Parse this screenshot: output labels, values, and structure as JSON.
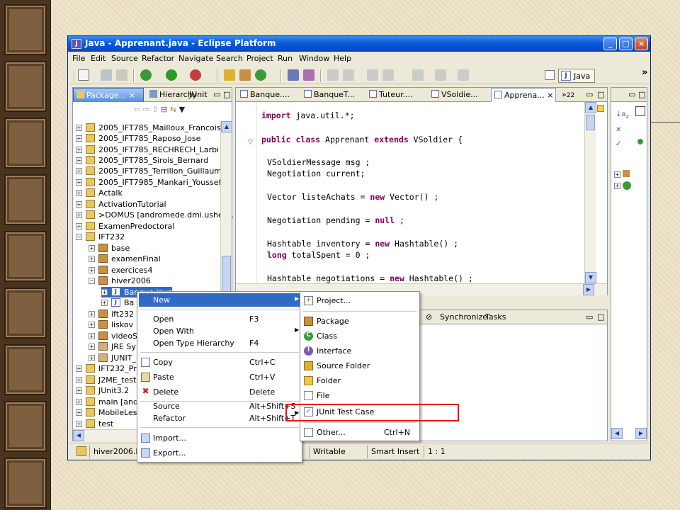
{
  "window": {
    "title": "Java - Apprenant.java - Eclipse Platform",
    "icon": "eclipse-icon"
  },
  "menubar": [
    "File",
    "Edit",
    "Source",
    "Refactor",
    "Navigate",
    "Search",
    "Project",
    "Run",
    "Window",
    "Help"
  ],
  "perspective": {
    "label": "Java",
    "overflow": "»"
  },
  "package_explorer": {
    "tabs": [
      "Package...",
      "Hierarchy",
      "JUnit"
    ],
    "items": [
      "2005_IFT785_Mailloux_Francois",
      "2005_IFT785_Raposo_Jose",
      "2005_IFT785_RECHRECH_Larbi",
      "2005_IFT785_Sirois_Bernard",
      "2005_IFT785_Terrillon_Guillaume",
      "2005_IFT7985_Mankari_Youssef",
      "Actalk",
      "ActivationTutorial",
      ">DOMUS  [andromede.dmi.usherb.",
      "ExamenPredoctoral",
      "IFT232",
      "base",
      "examenFinal",
      "exercices4",
      "hiver2006",
      "Banque.java",
      "Ba",
      "ift232",
      "liskov",
      "videoS",
      "JRE Sy",
      "JUNIT_",
      "IFT232_Pro",
      "J2ME_tests",
      "JUnit3.2",
      "main  [and",
      "MobileLess",
      "test"
    ]
  },
  "editor": {
    "tabs": [
      "Banque....",
      "BanqueT...",
      "Tuteur....",
      "VSoldie...",
      "Apprena...",
      "22"
    ],
    "overflow": "»",
    "code": {
      "l1_kw": "import",
      "l1_rest": " java.util.*;",
      "l2_kw1": "public",
      "l2_kw2": "class",
      "l2_mid": " Apprenant ",
      "l2_kw3": "extends",
      "l2_rest": " VSoldier {",
      "l3": "VSoldierMessage msg ;",
      "l4": "Negotiation current;",
      "l5_a": "Vector listeAchats = ",
      "l5_kw": "new",
      "l5_b": " Vector() ;",
      "l6_a": "Negotiation pending = ",
      "l6_kw": "null",
      "l6_b": " ;",
      "l7_a": "Hashtable inventory = ",
      "l7_kw": "new",
      "l7_b": " Hashtable() ;",
      "l8_kw": "long",
      "l8_b": " totalSpent = 0 ;",
      "l9_a": "Hashtable negotiations = ",
      "l9_kw": "new",
      "l9_b": " Hashtable() ;"
    }
  },
  "bottom_panel": {
    "tabs": [
      "Synchronize",
      "Tasks"
    ]
  },
  "status": {
    "left": "hiver2006.B",
    "writable": "Writable",
    "insert_mode": "Smart Insert",
    "position": "1 : 1"
  },
  "context_menu": {
    "items": [
      {
        "label": "New",
        "shortcut": ""
      },
      {
        "label": "Open",
        "shortcut": "F3"
      },
      {
        "label": "Open With",
        "shortcut": ""
      },
      {
        "label": "Open Type Hierarchy",
        "shortcut": "F4"
      },
      {
        "label": "Copy",
        "shortcut": "Ctrl+C"
      },
      {
        "label": "Paste",
        "shortcut": "Ctrl+V"
      },
      {
        "label": "Delete",
        "shortcut": "Delete"
      },
      {
        "label": "Source",
        "shortcut": "Alt+Shift+S"
      },
      {
        "label": "Refactor",
        "shortcut": "Alt+Shift+T"
      },
      {
        "label": "Import...",
        "shortcut": ""
      },
      {
        "label": "Export...",
        "shortcut": ""
      }
    ]
  },
  "submenu": {
    "items": [
      {
        "label": "Project...",
        "shortcut": ""
      },
      {
        "label": "Package",
        "shortcut": ""
      },
      {
        "label": "Class",
        "shortcut": ""
      },
      {
        "label": "Interface",
        "shortcut": ""
      },
      {
        "label": "Source Folder",
        "shortcut": ""
      },
      {
        "label": "Folder",
        "shortcut": ""
      },
      {
        "label": "File",
        "shortcut": ""
      },
      {
        "label": "JUnit Test Case",
        "shortcut": ""
      },
      {
        "label": "Other...",
        "shortcut": "Ctrl+N"
      }
    ]
  },
  "colors": {
    "title_blue": "#0a5ad8",
    "highlight": "#316ac5",
    "keyword": "#7f0055",
    "annotation_red": "#e8141c"
  }
}
